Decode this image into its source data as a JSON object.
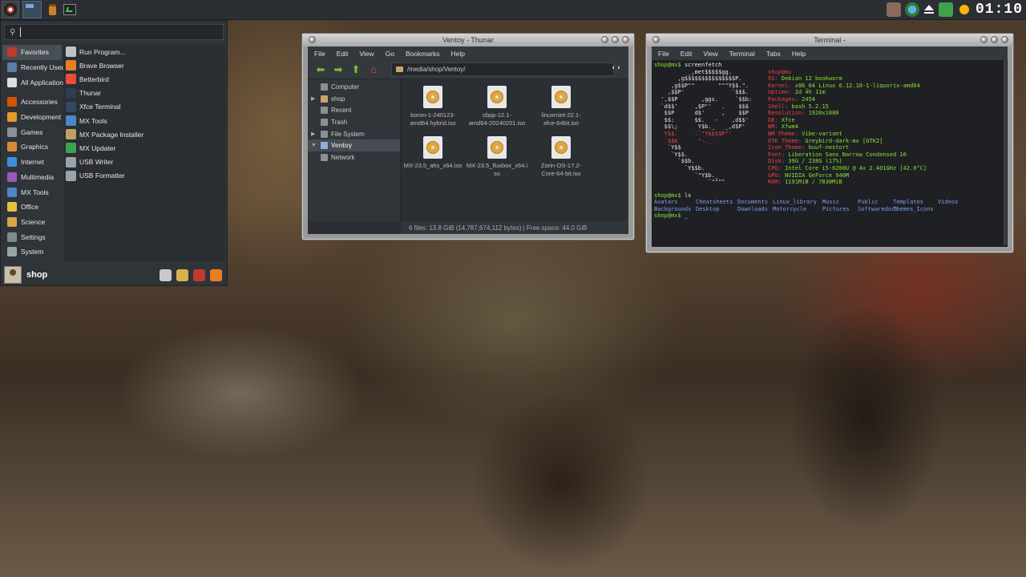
{
  "panel": {
    "clock": "01:10"
  },
  "whisker": {
    "search_placeholder": "",
    "categories": [
      {
        "label": "Favorites",
        "color": "#c0392b"
      },
      {
        "label": "Recently Used",
        "color": "#5b7fa6"
      },
      {
        "label": "All Applications",
        "color": "#dddddd"
      },
      {
        "label": "Accessories",
        "color": "#d35400"
      },
      {
        "label": "Development",
        "color": "#e59a2b"
      },
      {
        "label": "Games",
        "color": "#8a8f95"
      },
      {
        "label": "Graphics",
        "color": "#d68a3a"
      },
      {
        "label": "Internet",
        "color": "#3d8fd6"
      },
      {
        "label": "Multimedia",
        "color": "#9b59b6"
      },
      {
        "label": "MX Tools",
        "color": "#4a86c8"
      },
      {
        "label": "Office",
        "color": "#e2c23a"
      },
      {
        "label": "Science",
        "color": "#d6a84a"
      },
      {
        "label": "Settings",
        "color": "#7f8c8d"
      },
      {
        "label": "System",
        "color": "#95a5a6"
      }
    ],
    "apps": [
      {
        "label": "Run Program...",
        "color": "#bdc3c7"
      },
      {
        "label": "Brave Browser",
        "color": "#e67e22"
      },
      {
        "label": "Betterbird",
        "color": "#e74c3c"
      },
      {
        "label": "Thunar",
        "color": "#2c3e50"
      },
      {
        "label": "Xfce Terminal",
        "color": "#34495e"
      },
      {
        "label": "MX Tools",
        "color": "#4a86c8"
      },
      {
        "label": "MX Package Installer",
        "color": "#c0a060"
      },
      {
        "label": "MX Updater",
        "color": "#3fa34d"
      },
      {
        "label": "USB Writer",
        "color": "#9aa3ab"
      },
      {
        "label": "USB Formatter",
        "color": "#9aa3ab"
      }
    ],
    "user": "shop"
  },
  "thunar": {
    "title": "Ventoy - Thunar",
    "menu": [
      "File",
      "Edit",
      "View",
      "Go",
      "Bookmarks",
      "Help"
    ],
    "path": "/media/shop/Ventoy/",
    "sidebar": [
      {
        "label": "Computer",
        "arrow": "",
        "type": "heading"
      },
      {
        "label": "shop",
        "arrow": "▶",
        "type": "fold"
      },
      {
        "label": "Recent",
        "arrow": "",
        "type": "plain"
      },
      {
        "label": "Trash",
        "arrow": "",
        "type": "plain"
      },
      {
        "label": "File System",
        "arrow": "▶",
        "type": "plain"
      },
      {
        "label": "Ventoy",
        "arrow": "▼",
        "type": "usb"
      },
      {
        "label": "Network",
        "arrow": "",
        "type": "heading"
      }
    ],
    "files": [
      {
        "line1": "boron-1-240123-",
        "line2": "amd64.hybrid.iso"
      },
      {
        "line1": "cbpp-12.1-",
        "line2": "amd64-20240201.iso"
      },
      {
        "line1": "linuxmint-22.1-",
        "line2": "xfce-64bit.iso"
      },
      {
        "line1": "MX-23.5_ahs_x64.iso",
        "line2": ""
      },
      {
        "line1": "MX-23.5_fluxbox_x64.i",
        "line2": "so"
      },
      {
        "line1": "Zorin-OS-17.2-",
        "line2": "Core-64-bit.iso"
      }
    ],
    "status": "6 files: 13.8 GiB (14,787,674,112 bytes)  |  Free space: 44.0 GiB"
  },
  "terminal": {
    "title": "Terminal -",
    "menu": [
      "File",
      "Edit",
      "View",
      "Terminal",
      "Tabs",
      "Help"
    ],
    "prompt": "shop@mx$",
    "cmd1": "screenfetch",
    "art": [
      "          _,met$$$$$gg.",
      "       ,g$$$$$$$$$$$$$$$P.",
      "     ,g$$P\"\"       \"\"\"Y$$.\".",
      "    ,$$P'              `$$$.",
      "  ',$$P       ,ggs.     `$$b:",
      "  `d$$'     ,$P\"'   .    $$$",
      "   $$P      d$'     ,    $$P",
      "   $$:      $$.   -    ,d$$'",
      "   $$\\;      Y$b._   _,d$P'",
      "   Y$$.    `.`\"Y$$$$P\"'",
      "   `$$b      \"-.__",
      "    `Y$$",
      "     `Y$$.",
      "       `$$b.",
      "         `Y$$b.",
      "            `\"Y$b._",
      "                `\"\"\"\""
    ],
    "user_host": "shop@mx",
    "info": [
      {
        "k": "OS:",
        "v": "Debian 12 bookworm"
      },
      {
        "k": "Kernel:",
        "v": "x86_64 Linux 6.12.10-1-liquorix-amd64"
      },
      {
        "k": "Uptime:",
        "v": "2d 4h 11m"
      },
      {
        "k": "Packages:",
        "v": "2454"
      },
      {
        "k": "Shell:",
        "v": "bash 5.2.15"
      },
      {
        "k": "Resolution:",
        "v": "1920x1080"
      },
      {
        "k": "DE:",
        "v": "Xfce"
      },
      {
        "k": "WM:",
        "v": "Xfwm4"
      },
      {
        "k": "WM Theme:",
        "v": "Vibe-variant"
      },
      {
        "k": "GTK Theme:",
        "v": "Greybird-dark-mx [GTK2]"
      },
      {
        "k": "Icon Theme:",
        "v": "buuf-nestort"
      },
      {
        "k": "Font:",
        "v": "Liberation Sans Narrow Condensed 10"
      },
      {
        "k": "Disk:",
        "v": "39G / 238G (17%)"
      },
      {
        "k": "CPU:",
        "v": "Intel Core i5-6200U @ 4x 2.401GHz [42.0°C]"
      },
      {
        "k": "GPU:",
        "v": "NVIDIA GeForce 940M"
      },
      {
        "k": "RAM:",
        "v": "1191MiB / 7830MiB"
      }
    ],
    "cmd2": "ls",
    "ls": [
      "Avatars",
      "Cheatsheets",
      "Documents",
      "Linux_library",
      "Music",
      "Public",
      "Templates",
      "Videos",
      "Backgrounds",
      "Desktop",
      "Downloads",
      "Motorcycle",
      "Pictures",
      "Softwaredocs",
      "Themes_Icons",
      ""
    ],
    "cursor": "_"
  }
}
